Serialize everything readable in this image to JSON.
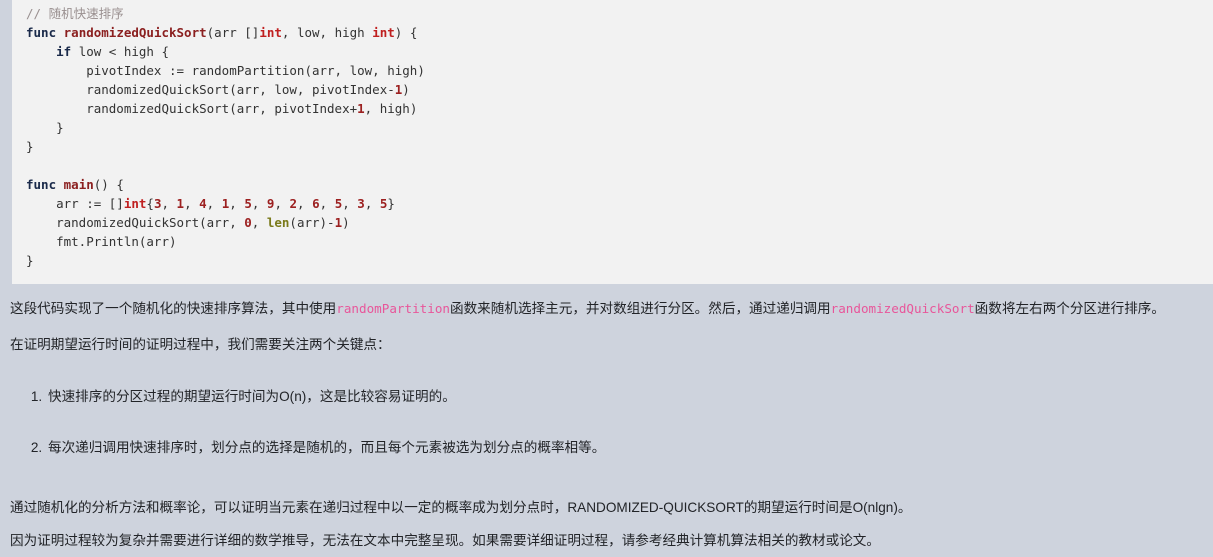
{
  "code_block": {
    "language": "go",
    "lines": [
      [
        {
          "t": "// 随机快速排序",
          "c": "cmt"
        }
      ],
      [
        {
          "t": "func ",
          "c": "kw"
        },
        {
          "t": "randomizedQuickSort",
          "c": "fn"
        },
        {
          "t": "(arr []",
          "c": "pl"
        },
        {
          "t": "int",
          "c": "type"
        },
        {
          "t": ", low, high ",
          "c": "pl"
        },
        {
          "t": "int",
          "c": "type"
        },
        {
          "t": ") {",
          "c": "pl"
        }
      ],
      [
        {
          "t": "    ",
          "c": "pl"
        },
        {
          "t": "if",
          "c": "kw"
        },
        {
          "t": " low < high {",
          "c": "pl"
        }
      ],
      [
        {
          "t": "        pivotIndex := randomPartition(arr, low, high)",
          "c": "pl"
        }
      ],
      [
        {
          "t": "        randomizedQuickSort(arr, low, pivotIndex-",
          "c": "pl"
        },
        {
          "t": "1",
          "c": "num"
        },
        {
          "t": ")",
          "c": "pl"
        }
      ],
      [
        {
          "t": "        randomizedQuickSort(arr, pivotIndex+",
          "c": "pl"
        },
        {
          "t": "1",
          "c": "num"
        },
        {
          "t": ", high)",
          "c": "pl"
        }
      ],
      [
        {
          "t": "    }",
          "c": "pl"
        }
      ],
      [
        {
          "t": "}",
          "c": "pl"
        }
      ],
      [
        {
          "t": "",
          "c": "pl"
        }
      ],
      [
        {
          "t": "func ",
          "c": "kw"
        },
        {
          "t": "main",
          "c": "fn"
        },
        {
          "t": "() {",
          "c": "pl"
        }
      ],
      [
        {
          "t": "    arr := []",
          "c": "pl"
        },
        {
          "t": "int",
          "c": "type"
        },
        {
          "t": "{",
          "c": "pl"
        },
        {
          "t": "3",
          "c": "num"
        },
        {
          "t": ", ",
          "c": "pl"
        },
        {
          "t": "1",
          "c": "num"
        },
        {
          "t": ", ",
          "c": "pl"
        },
        {
          "t": "4",
          "c": "num"
        },
        {
          "t": ", ",
          "c": "pl"
        },
        {
          "t": "1",
          "c": "num"
        },
        {
          "t": ", ",
          "c": "pl"
        },
        {
          "t": "5",
          "c": "num"
        },
        {
          "t": ", ",
          "c": "pl"
        },
        {
          "t": "9",
          "c": "num"
        },
        {
          "t": ", ",
          "c": "pl"
        },
        {
          "t": "2",
          "c": "num"
        },
        {
          "t": ", ",
          "c": "pl"
        },
        {
          "t": "6",
          "c": "num"
        },
        {
          "t": ", ",
          "c": "pl"
        },
        {
          "t": "5",
          "c": "num"
        },
        {
          "t": ", ",
          "c": "pl"
        },
        {
          "t": "3",
          "c": "num"
        },
        {
          "t": ", ",
          "c": "pl"
        },
        {
          "t": "5",
          "c": "num"
        },
        {
          "t": "}",
          "c": "pl"
        }
      ],
      [
        {
          "t": "    randomizedQuickSort(arr, ",
          "c": "pl"
        },
        {
          "t": "0",
          "c": "num"
        },
        {
          "t": ", ",
          "c": "pl"
        },
        {
          "t": "len",
          "c": "bi"
        },
        {
          "t": "(arr)-",
          "c": "pl"
        },
        {
          "t": "1",
          "c": "num"
        },
        {
          "t": ")",
          "c": "pl"
        }
      ],
      [
        {
          "t": "    fmt.Println(arr)",
          "c": "pl"
        }
      ],
      [
        {
          "t": "}",
          "c": "pl"
        }
      ]
    ]
  },
  "prose": {
    "paragraph_1": {
      "segment_1": "这段代码实现了一个随机化的快速排序算法，其中使用",
      "code_1": "randomPartition",
      "segment_2": "函数来随机选择主元，并对数组进行分区。然后，通过递归调用",
      "code_2": "randomizedQuickSort",
      "segment_3": "函数将左右两个分区进行排序。"
    },
    "paragraph_2": "在证明期望运行时间的证明过程中，我们需要关注两个关键点：",
    "list_items": [
      "快速排序的分区过程的期望运行时间为O(n)，这是比较容易证明的。",
      "每次递归调用快速排序时，划分点的选择是随机的，而且每个元素被选为划分点的概率相等。"
    ],
    "paragraph_3": "通过随机化的分析方法和概率论，可以证明当元素在递归过程中以一定的概率成为划分点时，RANDOMIZED-QUICKSORT的期望运行时间是O(nlgn)。",
    "paragraph_4": "因为证明过程较为复杂并需要进行详细的数学推导，无法在文本中完整呈现。如果需要详细证明过程，请参考经典计算机算法相关的教材或论文。"
  },
  "colors": {
    "page_background": "#ced3dd",
    "code_background": "#f2f2f2",
    "inline_code": "#e8569a",
    "code_keyword": "#1a2a4a",
    "code_function": "#8b2020",
    "code_type": "#c02020",
    "code_number": "#9c2020",
    "code_builtin": "#7a7a1a",
    "code_comment": "#998f8f",
    "text": "#222428"
  }
}
